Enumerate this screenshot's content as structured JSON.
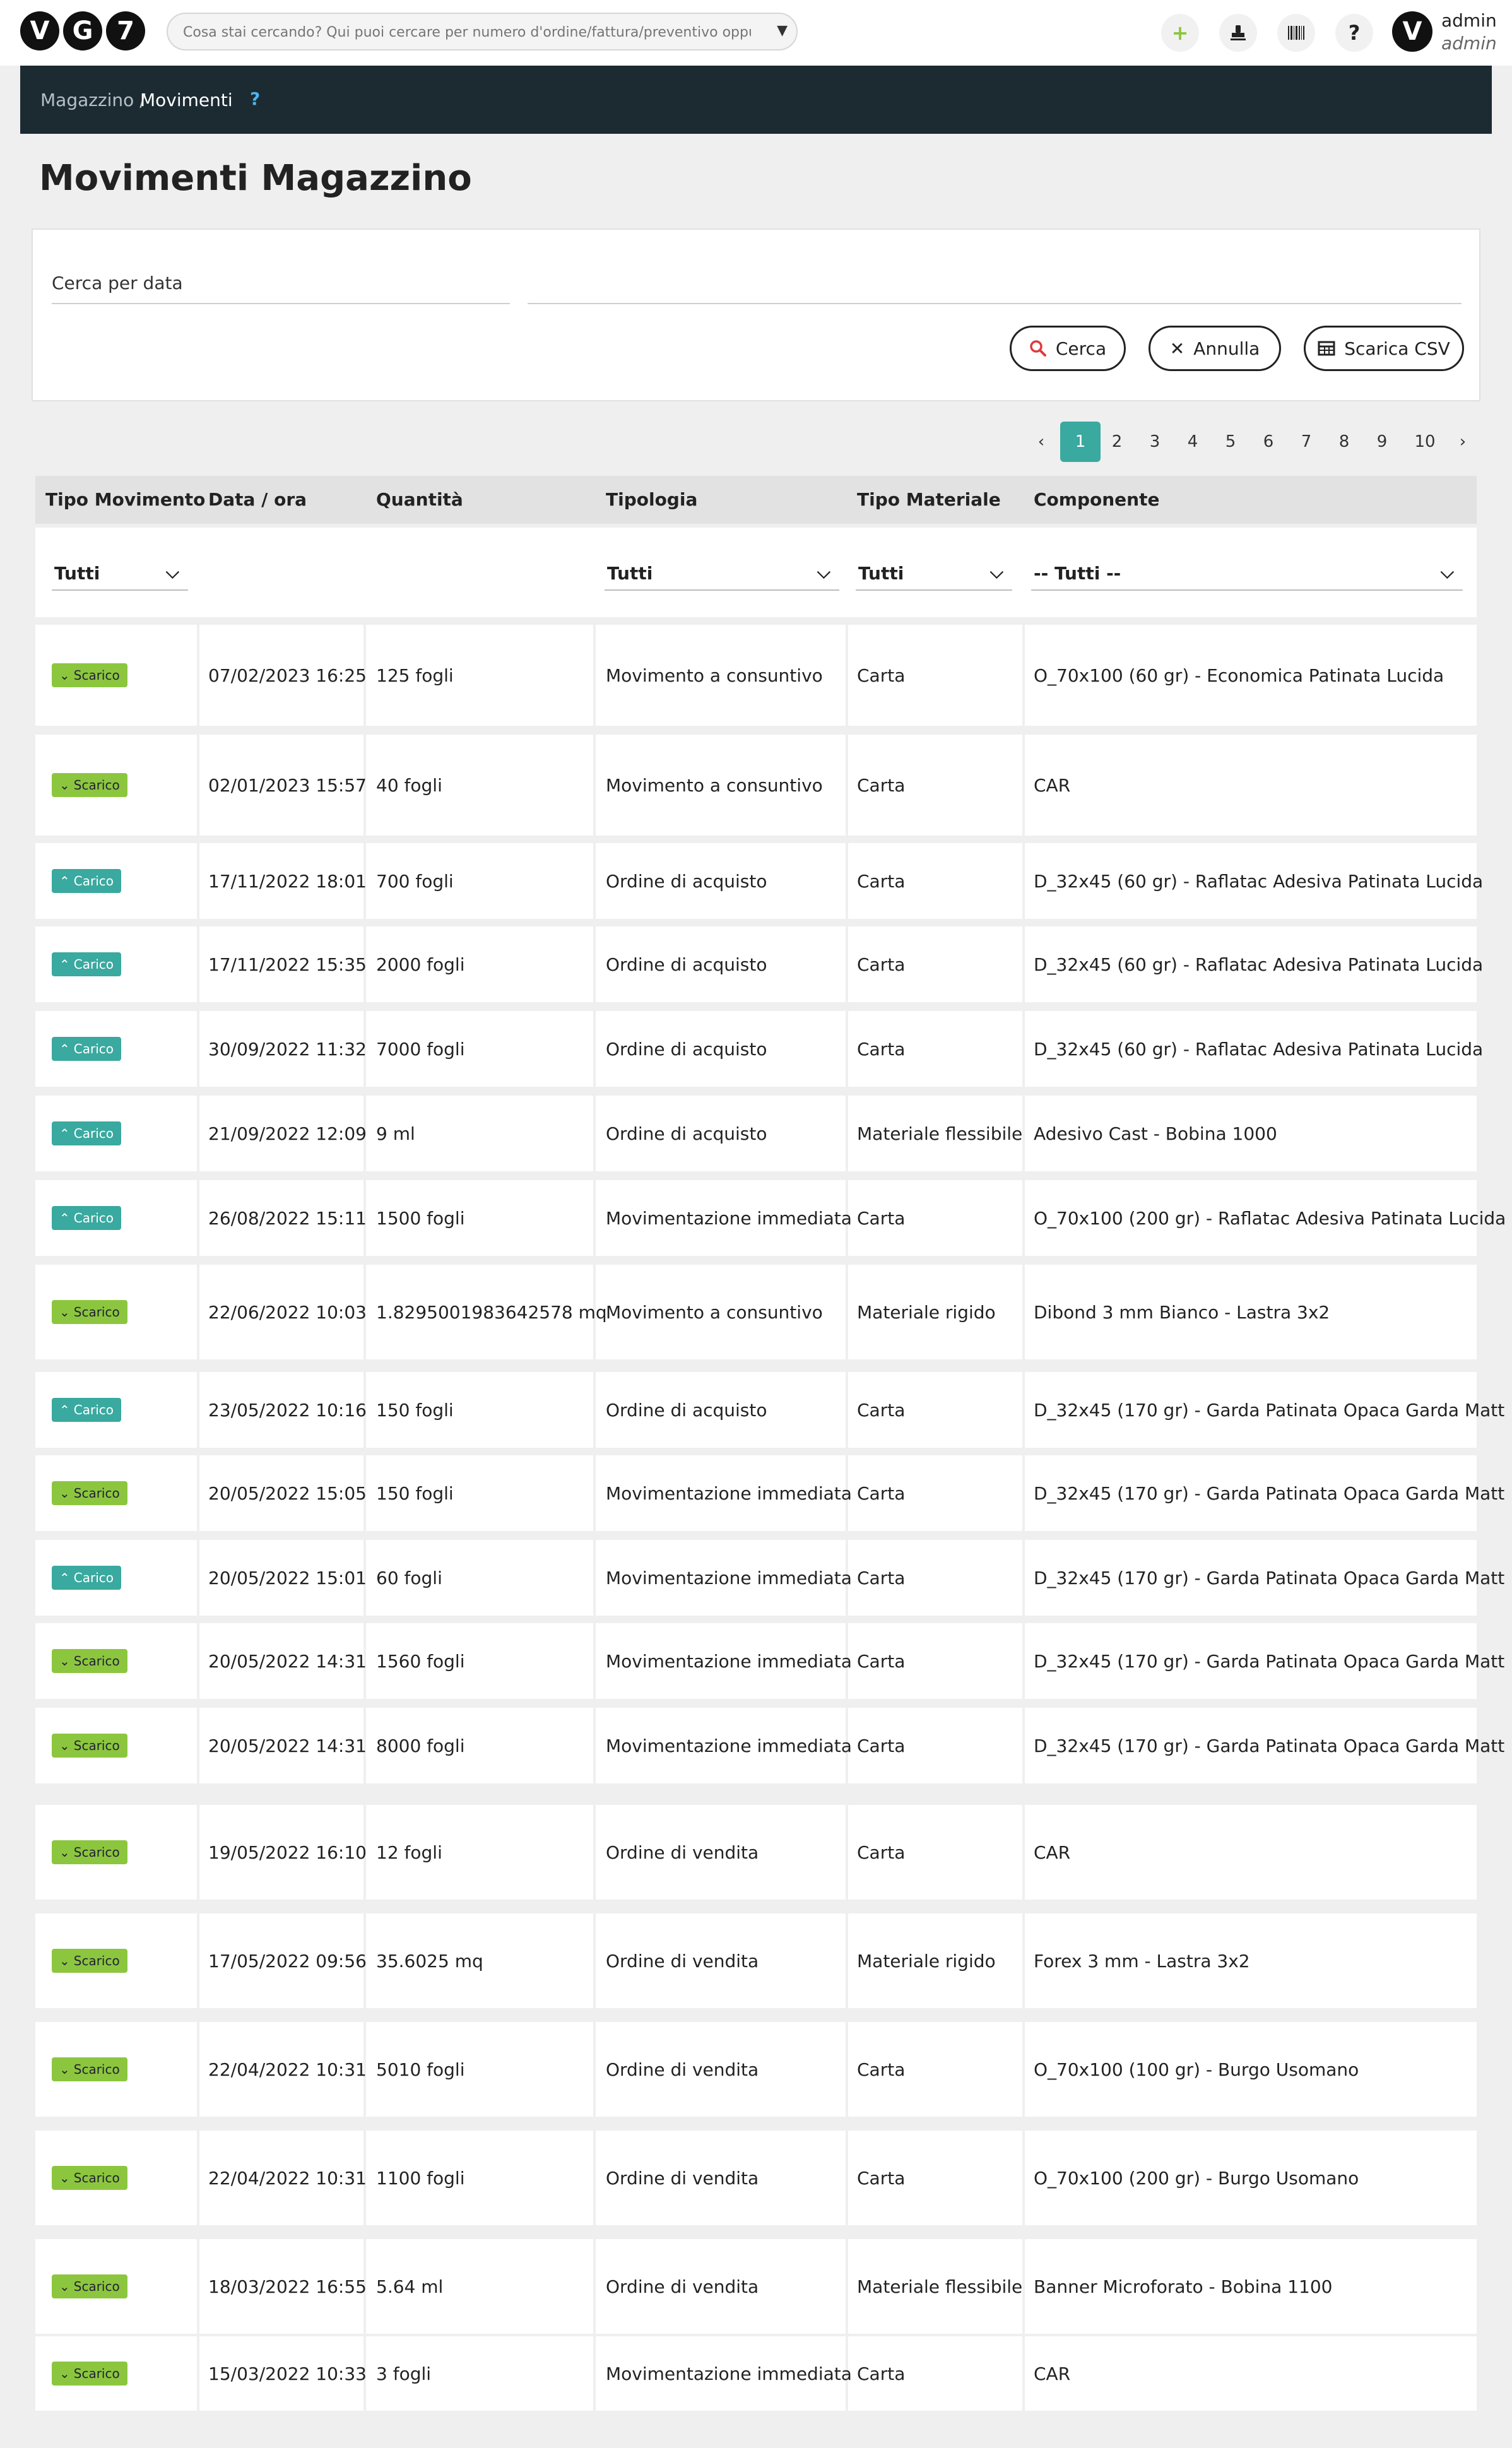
{
  "header": {
    "logo": "VG7",
    "search_placeholder": "Cosa stai cercando? Qui puoi cercare per numero d'ordine/fattura/preventivo oppure un cl...",
    "user_name": "admin",
    "user_role": "admin"
  },
  "breadcrumb": {
    "parent": "Magazzino /",
    "current": "Movimenti",
    "help": "?"
  },
  "page": {
    "title": "Movimenti Magazzino"
  },
  "filters": {
    "date_label": "Cerca per data",
    "search_button": "Cerca",
    "cancel_button": "Annulla",
    "csv_button": "Scarica CSV"
  },
  "pagination": {
    "prev": "‹",
    "next": "›",
    "pages": [
      "1",
      "2",
      "3",
      "4",
      "5",
      "6",
      "7",
      "8",
      "9",
      "10"
    ],
    "active": "1"
  },
  "table": {
    "columns": [
      "Tipo Movimento",
      "Data / ora",
      "Quantità",
      "Tipologia",
      "Tipo Materiale",
      "Componente"
    ],
    "filter_values": {
      "tipo_movimento": "Tutti",
      "tipologia": "Tutti",
      "tipo_materiale": "Tutti",
      "componente": "-- Tutti --"
    },
    "rows": [
      {
        "type": "Scarico",
        "date": "07/02/2023 16:25",
        "qty": "125 fogli",
        "tipologia": "Movimento a consuntivo",
        "materiale": "Carta",
        "componente": "O_70x100 (60 gr) - Economica Patinata Lucida"
      },
      {
        "type": "Scarico",
        "date": "02/01/2023 15:57",
        "qty": "40 fogli",
        "tipologia": "Movimento a consuntivo",
        "materiale": "Carta",
        "componente": "CAR"
      },
      {
        "type": "Carico",
        "date": "17/11/2022 18:01",
        "qty": "700 fogli",
        "tipologia": "Ordine di acquisto",
        "materiale": "Carta",
        "componente": "D_32x45 (60 gr) - Raflatac Adesiva Patinata Lucida"
      },
      {
        "type": "Carico",
        "date": "17/11/2022 15:35",
        "qty": "2000 fogli",
        "tipologia": "Ordine di acquisto",
        "materiale": "Carta",
        "componente": "D_32x45 (60 gr) - Raflatac Adesiva Patinata Lucida"
      },
      {
        "type": "Carico",
        "date": "30/09/2022 11:32",
        "qty": "7000 fogli",
        "tipologia": "Ordine di acquisto",
        "materiale": "Carta",
        "componente": "D_32x45 (60 gr) - Raflatac Adesiva Patinata Lucida"
      },
      {
        "type": "Carico",
        "date": "21/09/2022 12:09",
        "qty": "9 ml",
        "tipologia": "Ordine di acquisto",
        "materiale": "Materiale flessibile",
        "componente": "Adesivo Cast - Bobina 1000"
      },
      {
        "type": "Carico",
        "date": "26/08/2022 15:11",
        "qty": "1500 fogli",
        "tipologia": "Movimentazione immediata",
        "materiale": "Carta",
        "componente": "O_70x100 (200 gr) - Raflatac Adesiva Patinata Lucida"
      },
      {
        "type": "Scarico",
        "date": "22/06/2022 10:03",
        "qty": "1.8295001983642578 mq",
        "tipologia": "Movimento a consuntivo",
        "materiale": "Materiale rigido",
        "componente": "Dibond 3 mm Bianco - Lastra 3x2"
      },
      {
        "type": "Carico",
        "date": "23/05/2022 10:16",
        "qty": "150 fogli",
        "tipologia": "Ordine di acquisto",
        "materiale": "Carta",
        "componente": "D_32x45 (170 gr) - Garda Patinata Opaca Garda Matt"
      },
      {
        "type": "Scarico",
        "date": "20/05/2022 15:05",
        "qty": "150 fogli",
        "tipologia": "Movimentazione immediata",
        "materiale": "Carta",
        "componente": "D_32x45 (170 gr) - Garda Patinata Opaca Garda Matt"
      },
      {
        "type": "Carico",
        "date": "20/05/2022 15:01",
        "qty": "60 fogli",
        "tipologia": "Movimentazione immediata",
        "materiale": "Carta",
        "componente": "D_32x45 (170 gr) - Garda Patinata Opaca Garda Matt"
      },
      {
        "type": "Scarico",
        "date": "20/05/2022 14:31",
        "qty": "1560 fogli",
        "tipologia": "Movimentazione immediata",
        "materiale": "Carta",
        "componente": "D_32x45 (170 gr) - Garda Patinata Opaca Garda Matt"
      },
      {
        "type": "Scarico",
        "date": "20/05/2022 14:31",
        "qty": "8000 fogli",
        "tipologia": "Movimentazione immediata",
        "materiale": "Carta",
        "componente": "D_32x45 (170 gr) - Garda Patinata Opaca Garda Matt"
      },
      {
        "type": "Scarico",
        "date": "19/05/2022 16:10",
        "qty": "12 fogli",
        "tipologia": "Ordine di vendita",
        "materiale": "Carta",
        "componente": "CAR"
      },
      {
        "type": "Scarico",
        "date": "17/05/2022 09:56",
        "qty": "35.6025 mq",
        "tipologia": "Ordine di vendita",
        "materiale": "Materiale rigido",
        "componente": "Forex 3 mm - Lastra 3x2"
      },
      {
        "type": "Scarico",
        "date": "22/04/2022 10:31",
        "qty": "5010 fogli",
        "tipologia": "Ordine di vendita",
        "materiale": "Carta",
        "componente": "O_70x100 (100 gr) - Burgo Usomano"
      },
      {
        "type": "Scarico",
        "date": "22/04/2022 10:31",
        "qty": "1100 fogli",
        "tipologia": "Ordine di vendita",
        "materiale": "Carta",
        "componente": "O_70x100 (200 gr) - Burgo Usomano"
      },
      {
        "type": "Scarico",
        "date": "18/03/2022 16:55",
        "qty": "5.64 ml",
        "tipologia": "Ordine di vendita",
        "materiale": "Materiale flessibile",
        "componente": "Banner Microforato - Bobina 1100"
      },
      {
        "type": "Scarico",
        "date": "15/03/2022 10:33",
        "qty": "3 fogli",
        "tipologia": "Movimentazione immediata",
        "materiale": "Carta",
        "componente": "CAR"
      }
    ]
  },
  "colors": {
    "scarico": "#8cc63f",
    "carico": "#3aa9a0",
    "header_dark": "#1c2a31",
    "accent_red": "#e03b3b"
  },
  "icons": {
    "add": "plus-icon",
    "stamp": "stamp-icon",
    "barcode": "barcode-icon",
    "help": "question-icon",
    "search": "search-icon",
    "cancel": "close-icon",
    "csv": "table-icon"
  }
}
